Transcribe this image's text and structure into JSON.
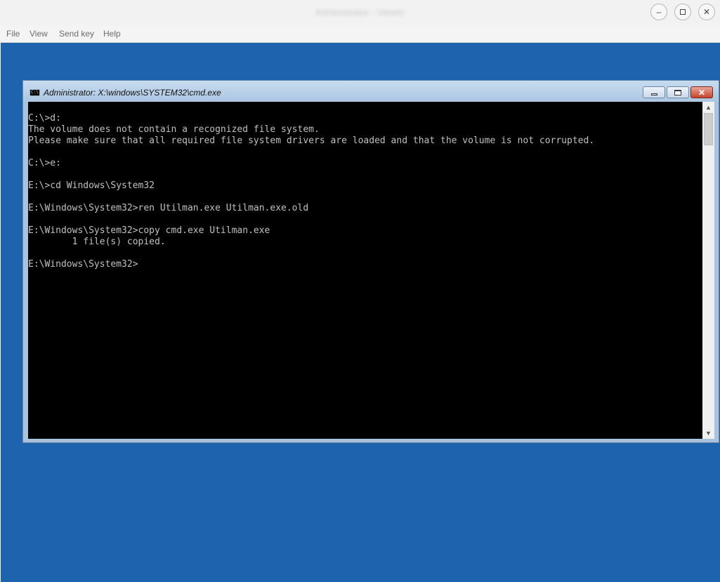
{
  "host": {
    "title": "Administrator - Viewer",
    "menu": [
      "File",
      "View",
      "Send key",
      "Help"
    ],
    "controls": {
      "minimize_icon": "minimize-icon",
      "maximize_icon": "maximize-icon",
      "close_icon": "close-icon"
    }
  },
  "cmd": {
    "title": "Administrator: X:\\windows\\SYSTEM32\\cmd.exe",
    "app_icon_text": "C:\\",
    "lines": [
      "C:\\>d:",
      "The volume does not contain a recognized file system.",
      "Please make sure that all required file system drivers are loaded and that the volume is not corrupted.",
      "",
      "C:\\>e:",
      "",
      "E:\\>cd Windows\\System32",
      "",
      "E:\\Windows\\System32>ren Utilman.exe Utilman.exe.old",
      "",
      "E:\\Windows\\System32>copy cmd.exe Utilman.exe",
      "        1 file(s) copied.",
      "",
      "E:\\Windows\\System32>"
    ]
  },
  "colors": {
    "desktop": "#1e63ad",
    "console_bg": "#000000",
    "console_fg": "#c0c0c0"
  }
}
